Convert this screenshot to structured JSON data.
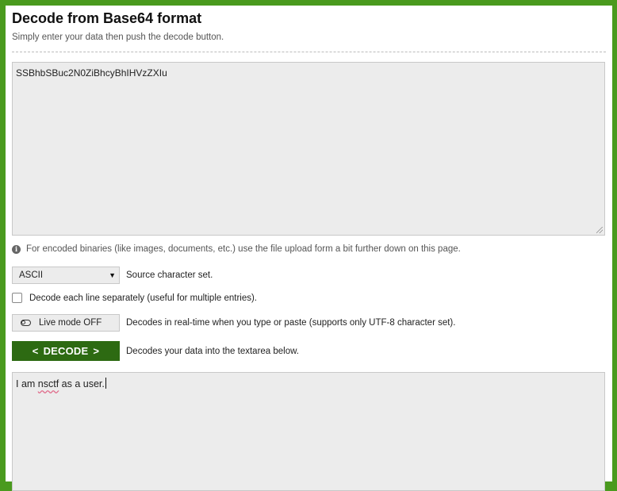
{
  "page": {
    "title": "Decode from Base64 format",
    "subtitle": "Simply enter your data then push the decode button."
  },
  "input": {
    "value": "SSBhbSBuc2N0ZiBhcyBhIHVzZXIu"
  },
  "info": {
    "text": "For encoded binaries (like images, documents, etc.) use the file upload form a bit further down on this page."
  },
  "charset": {
    "selected": "ASCII",
    "description": "Source character set."
  },
  "line_mode": {
    "label": "Decode each line separately (useful for multiple entries)."
  },
  "live_mode": {
    "label": "Live mode OFF",
    "description": "Decodes in real-time when you type or paste (supports only UTF-8 character set)."
  },
  "decode": {
    "label": "DECODE",
    "description": "Decodes your data into the textarea below."
  },
  "output": {
    "prefix": "I am ",
    "misspelled": "nsctf",
    "suffix": " as a user."
  },
  "colors": {
    "page_bg": "#4a9a1e",
    "decode_button": "#2d6a12",
    "field_bg": "#ececec"
  }
}
